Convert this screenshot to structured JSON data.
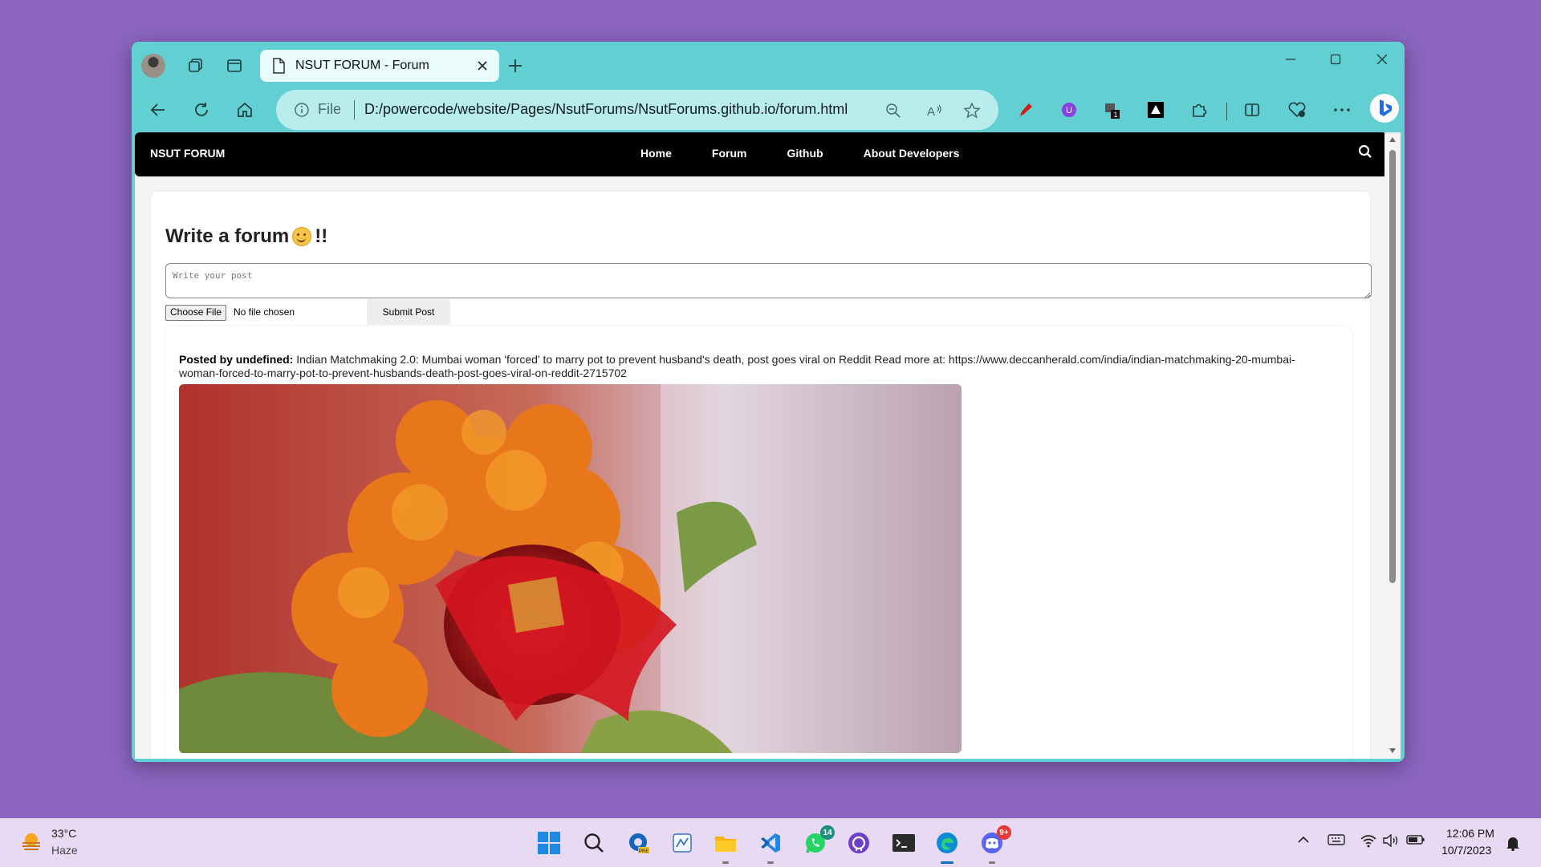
{
  "browser": {
    "tab_title": "NSUT FORUM - Forum",
    "address_scheme": "File",
    "url": "D:/powercode/website/Pages/NsutForums/NsutForums.github.io/forum.html",
    "extension_badge": "1"
  },
  "page": {
    "brand": "NSUT FORUM",
    "nav": [
      "Home",
      "Forum",
      "Github",
      "About Developers"
    ],
    "heading_prefix": "Write a forum",
    "heading_suffix": "!!",
    "textarea_placeholder": "Write your post",
    "choose_file_label": "Choose File",
    "file_status": "No file chosen",
    "submit_label": "Submit Post",
    "post": {
      "author_label": "Posted by undefined:",
      "content": "Indian Matchmaking 2.0: Mumbai woman 'forced' to marry pot to prevent husband's death, post goes viral on Reddit Read more at: https://www.deccanherald.com/india/indian-matchmaking-20-mumbai-woman-forced-to-marry-pot-to-prevent-husbands-death-post-goes-viral-on-reddit-2715702"
    }
  },
  "taskbar": {
    "weather_temp": "33°C",
    "weather_condition": "Haze",
    "whatsapp_badge": "14",
    "discord_badge": "9+",
    "time": "12:06 PM",
    "date": "10/7/2023"
  },
  "colors": {
    "desktop": "#8b65bf",
    "browser_frame": "#62d0d2",
    "navbar": "#000000",
    "taskbar": "#e8daf3"
  }
}
